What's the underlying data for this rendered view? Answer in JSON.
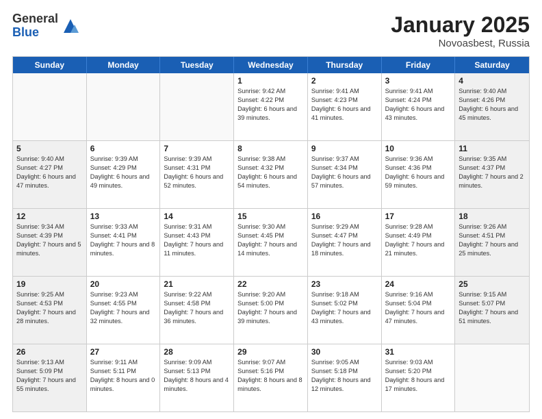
{
  "logo": {
    "general": "General",
    "blue": "Blue"
  },
  "title": "January 2025",
  "location": "Novoasbest, Russia",
  "dayHeaders": [
    "Sunday",
    "Monday",
    "Tuesday",
    "Wednesday",
    "Thursday",
    "Friday",
    "Saturday"
  ],
  "weeks": [
    [
      {
        "day": "",
        "info": "",
        "empty": true
      },
      {
        "day": "",
        "info": "",
        "empty": true
      },
      {
        "day": "",
        "info": "",
        "empty": true
      },
      {
        "day": "1",
        "info": "Sunrise: 9:42 AM\nSunset: 4:22 PM\nDaylight: 6 hours\nand 39 minutes."
      },
      {
        "day": "2",
        "info": "Sunrise: 9:41 AM\nSunset: 4:23 PM\nDaylight: 6 hours\nand 41 minutes."
      },
      {
        "day": "3",
        "info": "Sunrise: 9:41 AM\nSunset: 4:24 PM\nDaylight: 6 hours\nand 43 minutes."
      },
      {
        "day": "4",
        "info": "Sunrise: 9:40 AM\nSunset: 4:26 PM\nDaylight: 6 hours\nand 45 minutes."
      }
    ],
    [
      {
        "day": "5",
        "info": "Sunrise: 9:40 AM\nSunset: 4:27 PM\nDaylight: 6 hours\nand 47 minutes."
      },
      {
        "day": "6",
        "info": "Sunrise: 9:39 AM\nSunset: 4:29 PM\nDaylight: 6 hours\nand 49 minutes."
      },
      {
        "day": "7",
        "info": "Sunrise: 9:39 AM\nSunset: 4:31 PM\nDaylight: 6 hours\nand 52 minutes."
      },
      {
        "day": "8",
        "info": "Sunrise: 9:38 AM\nSunset: 4:32 PM\nDaylight: 6 hours\nand 54 minutes."
      },
      {
        "day": "9",
        "info": "Sunrise: 9:37 AM\nSunset: 4:34 PM\nDaylight: 6 hours\nand 57 minutes."
      },
      {
        "day": "10",
        "info": "Sunrise: 9:36 AM\nSunset: 4:36 PM\nDaylight: 6 hours\nand 59 minutes."
      },
      {
        "day": "11",
        "info": "Sunrise: 9:35 AM\nSunset: 4:37 PM\nDaylight: 7 hours\nand 2 minutes."
      }
    ],
    [
      {
        "day": "12",
        "info": "Sunrise: 9:34 AM\nSunset: 4:39 PM\nDaylight: 7 hours\nand 5 minutes."
      },
      {
        "day": "13",
        "info": "Sunrise: 9:33 AM\nSunset: 4:41 PM\nDaylight: 7 hours\nand 8 minutes."
      },
      {
        "day": "14",
        "info": "Sunrise: 9:31 AM\nSunset: 4:43 PM\nDaylight: 7 hours\nand 11 minutes."
      },
      {
        "day": "15",
        "info": "Sunrise: 9:30 AM\nSunset: 4:45 PM\nDaylight: 7 hours\nand 14 minutes."
      },
      {
        "day": "16",
        "info": "Sunrise: 9:29 AM\nSunset: 4:47 PM\nDaylight: 7 hours\nand 18 minutes."
      },
      {
        "day": "17",
        "info": "Sunrise: 9:28 AM\nSunset: 4:49 PM\nDaylight: 7 hours\nand 21 minutes."
      },
      {
        "day": "18",
        "info": "Sunrise: 9:26 AM\nSunset: 4:51 PM\nDaylight: 7 hours\nand 25 minutes."
      }
    ],
    [
      {
        "day": "19",
        "info": "Sunrise: 9:25 AM\nSunset: 4:53 PM\nDaylight: 7 hours\nand 28 minutes."
      },
      {
        "day": "20",
        "info": "Sunrise: 9:23 AM\nSunset: 4:55 PM\nDaylight: 7 hours\nand 32 minutes."
      },
      {
        "day": "21",
        "info": "Sunrise: 9:22 AM\nSunset: 4:58 PM\nDaylight: 7 hours\nand 36 minutes."
      },
      {
        "day": "22",
        "info": "Sunrise: 9:20 AM\nSunset: 5:00 PM\nDaylight: 7 hours\nand 39 minutes."
      },
      {
        "day": "23",
        "info": "Sunrise: 9:18 AM\nSunset: 5:02 PM\nDaylight: 7 hours\nand 43 minutes."
      },
      {
        "day": "24",
        "info": "Sunrise: 9:16 AM\nSunset: 5:04 PM\nDaylight: 7 hours\nand 47 minutes."
      },
      {
        "day": "25",
        "info": "Sunrise: 9:15 AM\nSunset: 5:07 PM\nDaylight: 7 hours\nand 51 minutes."
      }
    ],
    [
      {
        "day": "26",
        "info": "Sunrise: 9:13 AM\nSunset: 5:09 PM\nDaylight: 7 hours\nand 55 minutes."
      },
      {
        "day": "27",
        "info": "Sunrise: 9:11 AM\nSunset: 5:11 PM\nDaylight: 8 hours\nand 0 minutes."
      },
      {
        "day": "28",
        "info": "Sunrise: 9:09 AM\nSunset: 5:13 PM\nDaylight: 8 hours\nand 4 minutes."
      },
      {
        "day": "29",
        "info": "Sunrise: 9:07 AM\nSunset: 5:16 PM\nDaylight: 8 hours\nand 8 minutes."
      },
      {
        "day": "30",
        "info": "Sunrise: 9:05 AM\nSunset: 5:18 PM\nDaylight: 8 hours\nand 12 minutes."
      },
      {
        "day": "31",
        "info": "Sunrise: 9:03 AM\nSunset: 5:20 PM\nDaylight: 8 hours\nand 17 minutes."
      },
      {
        "day": "",
        "info": "",
        "empty": true
      }
    ]
  ]
}
